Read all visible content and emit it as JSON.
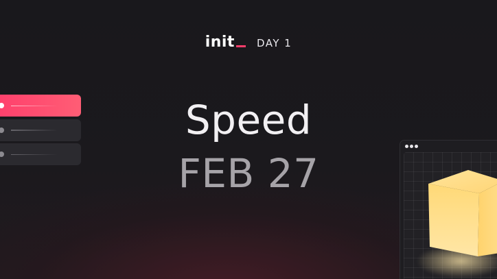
{
  "header": {
    "logo_text": "init",
    "day_label": "DAY 1"
  },
  "hero": {
    "title": "Speed",
    "date": "FEB 27"
  },
  "list": {
    "items": [
      {
        "active": true
      },
      {
        "active": false
      },
      {
        "active": false
      }
    ]
  },
  "colors": {
    "accent": "#ff3f6c",
    "background": "#19181c",
    "cube": "#ffd97a"
  },
  "icons": {
    "window_controls": "three-dots-icon",
    "decoration": "cube-icon"
  }
}
